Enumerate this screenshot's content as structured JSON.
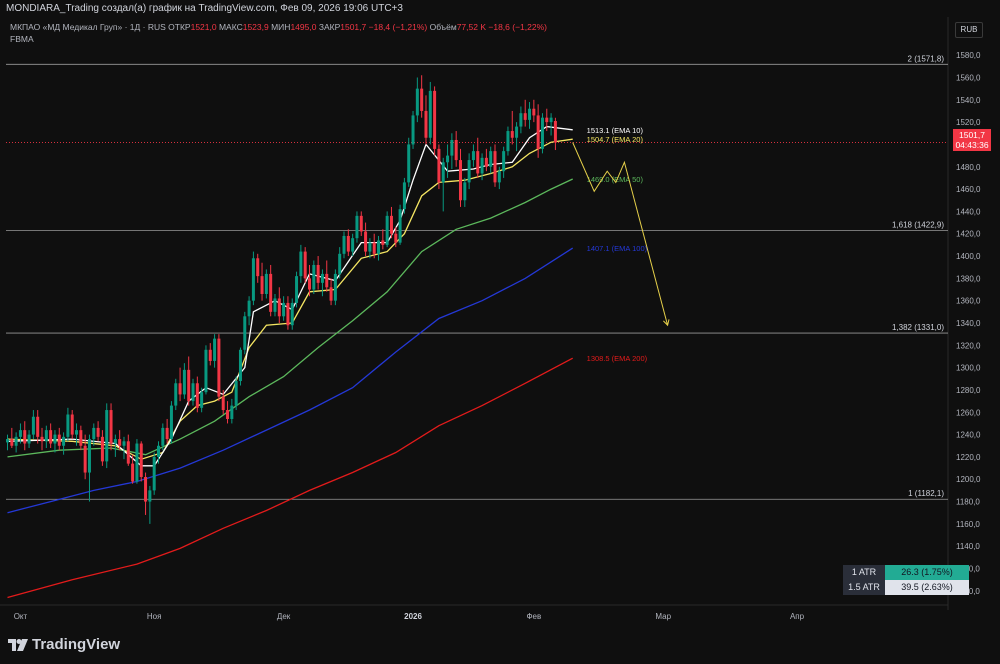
{
  "header": {
    "title": "MONDIARA_Trading создал(а) график на TradingView.com, Фев 09, 2026 19:06 UTC+3",
    "symbol": "МКПАО «МД Медикал Груп» · 1Д · RUS",
    "open_label": "ОТКР",
    "open": "1521,0",
    "high_label": "МАКС",
    "high": "1523,9",
    "low_label": "МИН",
    "low": "1495,0",
    "close_label": "ЗАКР",
    "close": "1501,7",
    "change": "−18,4 (−1,21%)",
    "volume_label": "Объём",
    "volume": "77,52 K",
    "volume_change": "−18,6 (−1,22%)",
    "indicator": "FBMA",
    "currency": "RUB"
  },
  "price_tag": {
    "price": "1501,7",
    "countdown": "04:43:36"
  },
  "atr": [
    {
      "label": "1 ATR",
      "value": "26.3 (1.75%)",
      "color": "#22ab94"
    },
    {
      "label": "1.5 ATR",
      "value": "39.5 (2.63%)",
      "color": "#e0e3eb"
    }
  ],
  "brand": "TradingView",
  "colors": {
    "up": "#089981",
    "down": "#f23645",
    "ema10": "#ffffff",
    "ema20": "#f5e663",
    "ema50": "#5cb85c",
    "ema100": "#2438d6",
    "ema200": "#e31b1b",
    "forecast": "#e6d04a",
    "fib": "#9a9a9a"
  },
  "chart_data": {
    "type": "candlestick",
    "y_axis": {
      "min": 1090,
      "max": 1590,
      "ticks": [
        1100,
        1120,
        1140,
        1160,
        1180,
        1200,
        1220,
        1240,
        1260,
        1280,
        1300,
        1320,
        1340,
        1360,
        1380,
        1400,
        1420,
        1440,
        1460,
        1480,
        1500,
        1520,
        1540,
        1560,
        1580
      ],
      "tick_format": "decimal-comma"
    },
    "x_ticks": [
      {
        "label": "Окт",
        "index": 3
      },
      {
        "label": "Ноя",
        "index": 34
      },
      {
        "label": "Дек",
        "index": 64
      },
      {
        "label": "2026",
        "index": 94
      },
      {
        "label": "Фев",
        "index": 122
      },
      {
        "label": "Мар",
        "index": 152
      },
      {
        "label": "Апр",
        "index": 183
      }
    ],
    "x_total": 218,
    "candles": [
      [
        1233,
        1240,
        1226,
        1236
      ],
      [
        1236,
        1246,
        1228,
        1230
      ],
      [
        1230,
        1242,
        1224,
        1238
      ],
      [
        1238,
        1250,
        1232,
        1244
      ],
      [
        1244,
        1252,
        1226,
        1232
      ],
      [
        1232,
        1244,
        1228,
        1240
      ],
      [
        1240,
        1262,
        1236,
        1256
      ],
      [
        1256,
        1262,
        1232,
        1238
      ],
      [
        1238,
        1246,
        1226,
        1234
      ],
      [
        1234,
        1248,
        1228,
        1244
      ],
      [
        1244,
        1250,
        1228,
        1232
      ],
      [
        1232,
        1244,
        1224,
        1240
      ],
      [
        1240,
        1246,
        1226,
        1230
      ],
      [
        1230,
        1242,
        1222,
        1238
      ],
      [
        1238,
        1264,
        1234,
        1258
      ],
      [
        1258,
        1262,
        1236,
        1240
      ],
      [
        1240,
        1250,
        1230,
        1244
      ],
      [
        1244,
        1248,
        1226,
        1230
      ],
      [
        1230,
        1240,
        1200,
        1206
      ],
      [
        1206,
        1240,
        1180,
        1236
      ],
      [
        1236,
        1250,
        1230,
        1246
      ],
      [
        1246,
        1252,
        1234,
        1238
      ],
      [
        1238,
        1244,
        1212,
        1216
      ],
      [
        1216,
        1268,
        1210,
        1262
      ],
      [
        1262,
        1268,
        1226,
        1232
      ],
      [
        1232,
        1240,
        1220,
        1236
      ],
      [
        1236,
        1244,
        1226,
        1230
      ],
      [
        1230,
        1238,
        1218,
        1234
      ],
      [
        1234,
        1240,
        1212,
        1214
      ],
      [
        1214,
        1222,
        1196,
        1198
      ],
      [
        1198,
        1236,
        1196,
        1232
      ],
      [
        1232,
        1234,
        1198,
        1202
      ],
      [
        1202,
        1206,
        1168,
        1180
      ],
      [
        1180,
        1194,
        1160,
        1190
      ],
      [
        1190,
        1224,
        1186,
        1220
      ],
      [
        1220,
        1234,
        1214,
        1230
      ],
      [
        1230,
        1250,
        1226,
        1246
      ],
      [
        1246,
        1254,
        1232,
        1236
      ],
      [
        1236,
        1270,
        1232,
        1266
      ],
      [
        1266,
        1290,
        1262,
        1286
      ],
      [
        1286,
        1300,
        1270,
        1276
      ],
      [
        1276,
        1304,
        1272,
        1298
      ],
      [
        1298,
        1310,
        1266,
        1270
      ],
      [
        1270,
        1290,
        1266,
        1286
      ],
      [
        1286,
        1292,
        1260,
        1264
      ],
      [
        1264,
        1282,
        1260,
        1278
      ],
      [
        1278,
        1320,
        1276,
        1316
      ],
      [
        1316,
        1322,
        1302,
        1306
      ],
      [
        1306,
        1330,
        1300,
        1326
      ],
      [
        1326,
        1330,
        1270,
        1274
      ],
      [
        1274,
        1280,
        1258,
        1262
      ],
      [
        1262,
        1270,
        1250,
        1254
      ],
      [
        1254,
        1272,
        1250,
        1266
      ],
      [
        1266,
        1292,
        1262,
        1288
      ],
      [
        1288,
        1318,
        1284,
        1316
      ],
      [
        1316,
        1350,
        1312,
        1346
      ],
      [
        1346,
        1364,
        1338,
        1360
      ],
      [
        1360,
        1404,
        1356,
        1398
      ],
      [
        1398,
        1402,
        1376,
        1382
      ],
      [
        1382,
        1394,
        1360,
        1366
      ],
      [
        1366,
        1388,
        1362,
        1384
      ],
      [
        1384,
        1392,
        1346,
        1350
      ],
      [
        1350,
        1366,
        1346,
        1362
      ],
      [
        1362,
        1372,
        1340,
        1346
      ],
      [
        1346,
        1364,
        1342,
        1358
      ],
      [
        1358,
        1364,
        1334,
        1338
      ],
      [
        1338,
        1362,
        1334,
        1358
      ],
      [
        1358,
        1386,
        1354,
        1382
      ],
      [
        1382,
        1410,
        1376,
        1404
      ],
      [
        1404,
        1408,
        1376,
        1380
      ],
      [
        1380,
        1392,
        1364,
        1370
      ],
      [
        1370,
        1396,
        1366,
        1392
      ],
      [
        1392,
        1400,
        1370,
        1376
      ],
      [
        1376,
        1388,
        1364,
        1384
      ],
      [
        1384,
        1396,
        1368,
        1372
      ],
      [
        1372,
        1380,
        1356,
        1360
      ],
      [
        1360,
        1388,
        1356,
        1384
      ],
      [
        1384,
        1408,
        1380,
        1402
      ],
      [
        1402,
        1422,
        1398,
        1418
      ],
      [
        1418,
        1424,
        1400,
        1404
      ],
      [
        1404,
        1420,
        1400,
        1416
      ],
      [
        1416,
        1440,
        1412,
        1436
      ],
      [
        1436,
        1440,
        1418,
        1422
      ],
      [
        1422,
        1430,
        1400,
        1404
      ],
      [
        1404,
        1416,
        1398,
        1412
      ],
      [
        1412,
        1420,
        1398,
        1402
      ],
      [
        1402,
        1418,
        1396,
        1414
      ],
      [
        1414,
        1424,
        1406,
        1410
      ],
      [
        1410,
        1440,
        1408,
        1436
      ],
      [
        1436,
        1444,
        1416,
        1420
      ],
      [
        1420,
        1426,
        1408,
        1412
      ],
      [
        1412,
        1446,
        1410,
        1442
      ],
      [
        1442,
        1470,
        1438,
        1466
      ],
      [
        1466,
        1506,
        1462,
        1500
      ],
      [
        1500,
        1530,
        1496,
        1526
      ],
      [
        1526,
        1560,
        1520,
        1550
      ],
      [
        1550,
        1562,
        1524,
        1530
      ],
      [
        1530,
        1544,
        1500,
        1506
      ],
      [
        1506,
        1556,
        1500,
        1548
      ],
      [
        1548,
        1552,
        1490,
        1496
      ],
      [
        1496,
        1500,
        1460,
        1466
      ],
      [
        1466,
        1488,
        1440,
        1484
      ],
      [
        1484,
        1500,
        1470,
        1490
      ],
      [
        1490,
        1510,
        1478,
        1504
      ],
      [
        1504,
        1512,
        1480,
        1486
      ],
      [
        1486,
        1496,
        1444,
        1450
      ],
      [
        1450,
        1470,
        1444,
        1466
      ],
      [
        1466,
        1492,
        1460,
        1486
      ],
      [
        1486,
        1500,
        1480,
        1494
      ],
      [
        1494,
        1506,
        1470,
        1474
      ],
      [
        1474,
        1492,
        1468,
        1488
      ],
      [
        1488,
        1496,
        1476,
        1480
      ],
      [
        1480,
        1498,
        1474,
        1494
      ],
      [
        1494,
        1500,
        1462,
        1466
      ],
      [
        1466,
        1480,
        1460,
        1476
      ],
      [
        1476,
        1498,
        1470,
        1494
      ],
      [
        1494,
        1516,
        1490,
        1512
      ],
      [
        1512,
        1530,
        1500,
        1506
      ],
      [
        1506,
        1520,
        1494,
        1516
      ],
      [
        1516,
        1534,
        1510,
        1528
      ],
      [
        1528,
        1540,
        1516,
        1522
      ],
      [
        1522,
        1538,
        1514,
        1532
      ],
      [
        1532,
        1540,
        1520,
        1526
      ],
      [
        1526,
        1536,
        1488,
        1496
      ],
      [
        1496,
        1528,
        1492,
        1524
      ],
      [
        1524,
        1532,
        1512,
        1520
      ],
      [
        1520,
        1528,
        1508,
        1524
      ],
      [
        1521,
        1523.9,
        1495,
        1501.7
      ]
    ],
    "ema": [
      {
        "name": "EMA 10",
        "label": "1513.1 (EMA 10)",
        "color": "#ffffff",
        "start": 1228,
        "end": 1513.1,
        "points": [
          [
            0,
            1234
          ],
          [
            15,
            1236
          ],
          [
            25,
            1232
          ],
          [
            31,
            1212
          ],
          [
            34,
            1212
          ],
          [
            38,
            1236
          ],
          [
            42,
            1270
          ],
          [
            46,
            1282
          ],
          [
            50,
            1276
          ],
          [
            55,
            1300
          ],
          [
            57,
            1350
          ],
          [
            62,
            1360
          ],
          [
            66,
            1352
          ],
          [
            70,
            1384
          ],
          [
            76,
            1378
          ],
          [
            82,
            1412
          ],
          [
            88,
            1412
          ],
          [
            91,
            1432
          ],
          [
            94,
            1468
          ],
          [
            97,
            1500
          ],
          [
            102,
            1476
          ],
          [
            108,
            1478
          ],
          [
            112,
            1482
          ],
          [
            117,
            1484
          ],
          [
            121,
            1506
          ],
          [
            125,
            1516
          ],
          [
            131,
            1513.1
          ]
        ]
      },
      {
        "name": "EMA 20",
        "label": "1504.7 (EMA 20)",
        "color": "#f5e663",
        "start": 1232,
        "end": 1504.7,
        "points": [
          [
            0,
            1236
          ],
          [
            15,
            1234
          ],
          [
            25,
            1230
          ],
          [
            31,
            1218
          ],
          [
            36,
            1224
          ],
          [
            40,
            1252
          ],
          [
            44,
            1266
          ],
          [
            48,
            1270
          ],
          [
            52,
            1278
          ],
          [
            56,
            1318
          ],
          [
            60,
            1338
          ],
          [
            66,
            1340
          ],
          [
            70,
            1368
          ],
          [
            76,
            1370
          ],
          [
            82,
            1398
          ],
          [
            88,
            1404
          ],
          [
            92,
            1420
          ],
          [
            96,
            1454
          ],
          [
            100,
            1466
          ],
          [
            106,
            1468
          ],
          [
            112,
            1474
          ],
          [
            117,
            1480
          ],
          [
            121,
            1492
          ],
          [
            126,
            1502
          ],
          [
            131,
            1504.7
          ]
        ]
      },
      {
        "name": "EMA 50",
        "label": "1469.0 (EMA 50)",
        "color": "#5cb85c",
        "start": 1220,
        "end": 1469,
        "points": [
          [
            0,
            1220
          ],
          [
            12,
            1226
          ],
          [
            24,
            1228
          ],
          [
            32,
            1222
          ],
          [
            40,
            1236
          ],
          [
            48,
            1252
          ],
          [
            56,
            1274
          ],
          [
            64,
            1292
          ],
          [
            72,
            1318
          ],
          [
            80,
            1342
          ],
          [
            88,
            1368
          ],
          [
            96,
            1404
          ],
          [
            104,
            1424
          ],
          [
            112,
            1434
          ],
          [
            120,
            1448
          ],
          [
            126,
            1460
          ],
          [
            131,
            1469
          ]
        ]
      },
      {
        "name": "EMA 100",
        "label": "1407.1 (EMA 100)",
        "color": "#2438d6",
        "start": 1170,
        "end": 1407.1,
        "points": [
          [
            0,
            1170
          ],
          [
            10,
            1180
          ],
          [
            20,
            1190
          ],
          [
            30,
            1198
          ],
          [
            40,
            1210
          ],
          [
            50,
            1226
          ],
          [
            60,
            1244
          ],
          [
            70,
            1262
          ],
          [
            80,
            1282
          ],
          [
            90,
            1314
          ],
          [
            100,
            1344
          ],
          [
            110,
            1360
          ],
          [
            120,
            1380
          ],
          [
            131,
            1407.1
          ]
        ]
      },
      {
        "name": "EMA 200",
        "label": "1308.5 (EMA 200)",
        "color": "#e31b1b",
        "start": 1094,
        "end": 1308.5,
        "points": [
          [
            0,
            1094
          ],
          [
            15,
            1110
          ],
          [
            30,
            1124
          ],
          [
            40,
            1138
          ],
          [
            50,
            1156
          ],
          [
            60,
            1172
          ],
          [
            70,
            1190
          ],
          [
            80,
            1206
          ],
          [
            90,
            1224
          ],
          [
            100,
            1248
          ],
          [
            110,
            1266
          ],
          [
            120,
            1286
          ],
          [
            131,
            1308.5
          ]
        ]
      }
    ],
    "fib_levels": [
      {
        "label": "2 (1571,8)",
        "value": 1571.8
      },
      {
        "label": "1,618 (1422,9)",
        "value": 1422.9
      },
      {
        "label": "1,382 (1331,0)",
        "value": 1331.0
      },
      {
        "label": "1 (1182,1)",
        "value": 1182.1
      }
    ],
    "last_price": 1501.7,
    "forecast_path": [
      [
        131,
        1501.7
      ],
      [
        136,
        1458
      ],
      [
        139,
        1476
      ],
      [
        141,
        1466
      ],
      [
        143,
        1484
      ],
      [
        153,
        1338
      ]
    ]
  }
}
